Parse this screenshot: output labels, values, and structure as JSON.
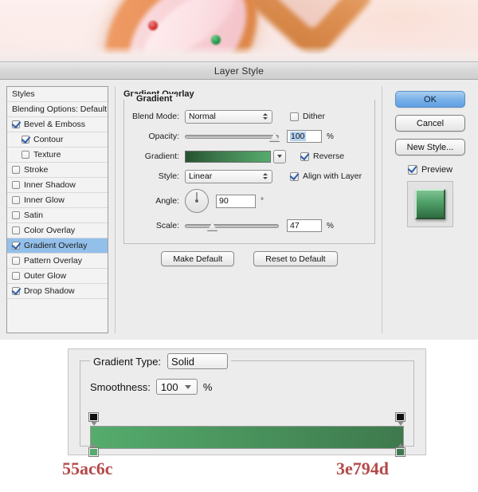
{
  "window": {
    "title": "Layer Style"
  },
  "photo": {
    "alt": "blurred cookie photo with pink icing and sprinkles"
  },
  "styles_panel": {
    "header": "Styles",
    "blending_options": "Blending Options: Default",
    "items": [
      {
        "label": "Bevel & Emboss",
        "checked": true,
        "indent": false,
        "selected": false
      },
      {
        "label": "Contour",
        "checked": true,
        "indent": true,
        "selected": false
      },
      {
        "label": "Texture",
        "checked": false,
        "indent": true,
        "selected": false
      },
      {
        "label": "Stroke",
        "checked": false,
        "indent": false,
        "selected": false
      },
      {
        "label": "Inner Shadow",
        "checked": false,
        "indent": false,
        "selected": false
      },
      {
        "label": "Inner Glow",
        "checked": false,
        "indent": false,
        "selected": false
      },
      {
        "label": "Satin",
        "checked": false,
        "indent": false,
        "selected": false
      },
      {
        "label": "Color Overlay",
        "checked": false,
        "indent": false,
        "selected": false
      },
      {
        "label": "Gradient Overlay",
        "checked": true,
        "indent": false,
        "selected": true
      },
      {
        "label": "Pattern Overlay",
        "checked": false,
        "indent": false,
        "selected": false
      },
      {
        "label": "Outer Glow",
        "checked": false,
        "indent": false,
        "selected": false
      },
      {
        "label": "Drop Shadow",
        "checked": true,
        "indent": false,
        "selected": false
      }
    ]
  },
  "settings": {
    "section_title": "Gradient Overlay",
    "group_title": "Gradient",
    "blend_mode": {
      "label": "Blend Mode:",
      "value": "Normal"
    },
    "dither": {
      "label": "Dither",
      "checked": false
    },
    "opacity": {
      "label": "Opacity:",
      "value": "100",
      "unit": "%",
      "slider_percent": 100
    },
    "gradient": {
      "label": "Gradient:",
      "swatch_from": "#24532f",
      "swatch_to": "#55ac6c"
    },
    "reverse": {
      "label": "Reverse",
      "checked": true
    },
    "style": {
      "label": "Style:",
      "value": "Linear"
    },
    "align_with_layer": {
      "label": "Align with Layer",
      "checked": true
    },
    "angle": {
      "label": "Angle:",
      "value": "90",
      "unit": "°",
      "degrees": 90
    },
    "scale": {
      "label": "Scale:",
      "value": "47",
      "unit": "%",
      "slider_percent": 27
    },
    "make_default": "Make Default",
    "reset_to_default": "Reset to Default"
  },
  "buttons": {
    "ok": "OK",
    "cancel": "Cancel",
    "new_style": "New Style...",
    "preview": {
      "label": "Preview",
      "checked": true
    }
  },
  "gradient_editor": {
    "type": {
      "label": "Gradient Type:",
      "value": "Solid"
    },
    "smoothness": {
      "label": "Smoothness:",
      "value": "100",
      "unit": "%"
    },
    "strip_from": "#55ac6c",
    "strip_to": "#3e794d",
    "stops": [
      {
        "kind": "opacity",
        "position": 0,
        "color": "#101010"
      },
      {
        "kind": "opacity",
        "position": 100,
        "color": "#101010"
      },
      {
        "kind": "color",
        "position": 0,
        "color": "#55ac6c"
      },
      {
        "kind": "color",
        "position": 100,
        "color": "#3e794d"
      }
    ]
  },
  "annotations": {
    "hex_left": "55ac6c",
    "hex_right": "3e794d",
    "hex_color": "#b54a4a"
  }
}
